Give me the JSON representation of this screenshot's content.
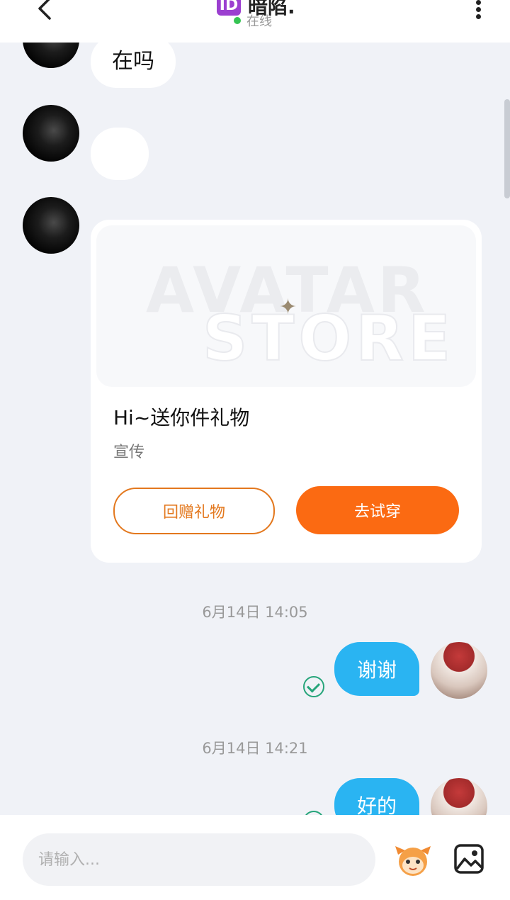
{
  "header": {
    "id_badge": "ID",
    "title": "暗陷.",
    "status": "在线"
  },
  "messages": {
    "incoming_1": "在吗",
    "incoming_2": ""
  },
  "gift_card": {
    "image_text_line1": "AVATAR",
    "image_text_line2": "STORE",
    "title": "Hi~送你件礼物",
    "subtitle": "宣传",
    "return_gift_label": "回赠礼物",
    "try_on_label": "去试穿"
  },
  "conversation": [
    {
      "time": "6月14日 14:05",
      "text": "谢谢"
    },
    {
      "time": "6月14日 14:21",
      "text": "好的"
    }
  ],
  "composer": {
    "placeholder": "请输入..."
  },
  "colors": {
    "accent_blue": "#2ab4f2",
    "accent_orange": "#fb6a12",
    "online_green": "#35c452",
    "read_check_green": "#26a57a"
  },
  "icons": [
    "back-arrow-icon",
    "more-vertical-icon",
    "id-badge-icon",
    "check-circle-icon",
    "emoji-mascot-icon",
    "image-icon",
    "sparkle-icon"
  ]
}
